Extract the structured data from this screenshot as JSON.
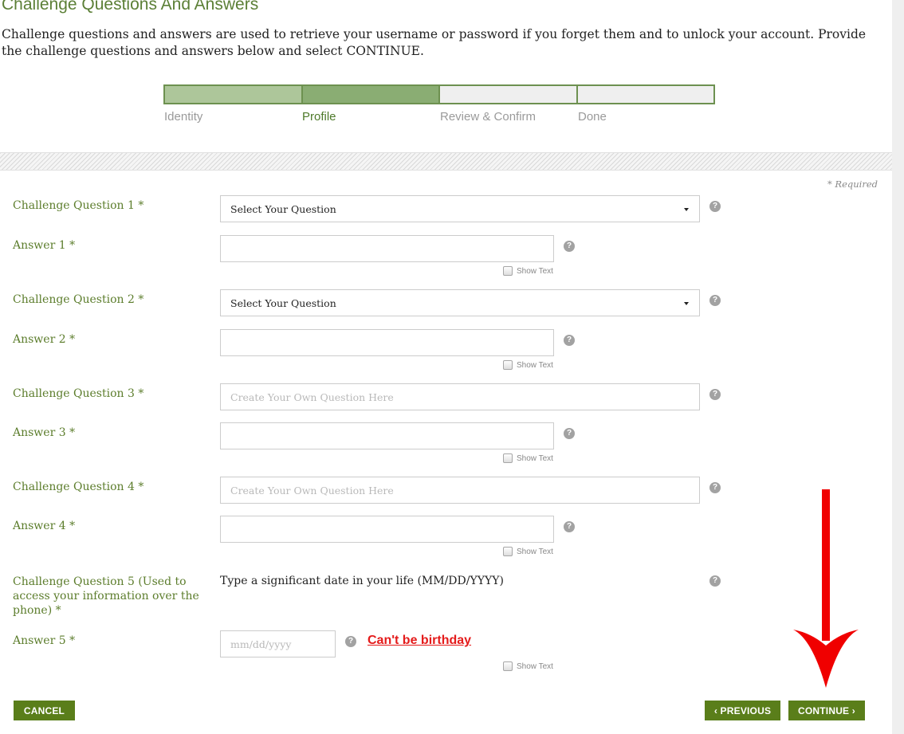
{
  "page": {
    "title": "Challenge Questions And Answers",
    "intro": "Challenge questions and answers are used to retrieve your username or password if you forget them and to unlock your account. Provide the challenge questions and answers below and select CONTINUE."
  },
  "steps": [
    "Identity",
    "Profile",
    "Review & Confirm",
    "Done"
  ],
  "active_step": "Profile",
  "required_note": "* Required",
  "help_glyph": "?",
  "show_text_label": "Show Text",
  "form": {
    "q1": {
      "label": "Challenge Question 1 *",
      "value": "Select Your Question"
    },
    "a1": {
      "label": "Answer 1 *"
    },
    "q2": {
      "label": "Challenge Question 2 *",
      "value": "Select Your Question"
    },
    "a2": {
      "label": "Answer 2 *"
    },
    "q3": {
      "label": "Challenge Question 3 *",
      "placeholder": "Create Your Own Question Here"
    },
    "a3": {
      "label": "Answer 3 *"
    },
    "q4": {
      "label": "Challenge Question 4 *",
      "placeholder": "Create Your Own Question Here"
    },
    "a4": {
      "label": "Answer 4 *"
    },
    "q5": {
      "label": "Challenge Question 5 (Used to access your information over the phone) *",
      "text": "Type a significant date in your life (MM/DD/YYYY)"
    },
    "a5": {
      "label": "Answer 5 *",
      "placeholder": "mm/dd/yyyy"
    }
  },
  "annotation": "Can't be birthday",
  "buttons": {
    "cancel": "CANCEL",
    "previous": "‹ PREVIOUS",
    "continue": "CONTINUE ›"
  },
  "colors": {
    "accent": "#5a7e1a",
    "label": "#5c7d2c",
    "annotation": "#e41b1b"
  }
}
